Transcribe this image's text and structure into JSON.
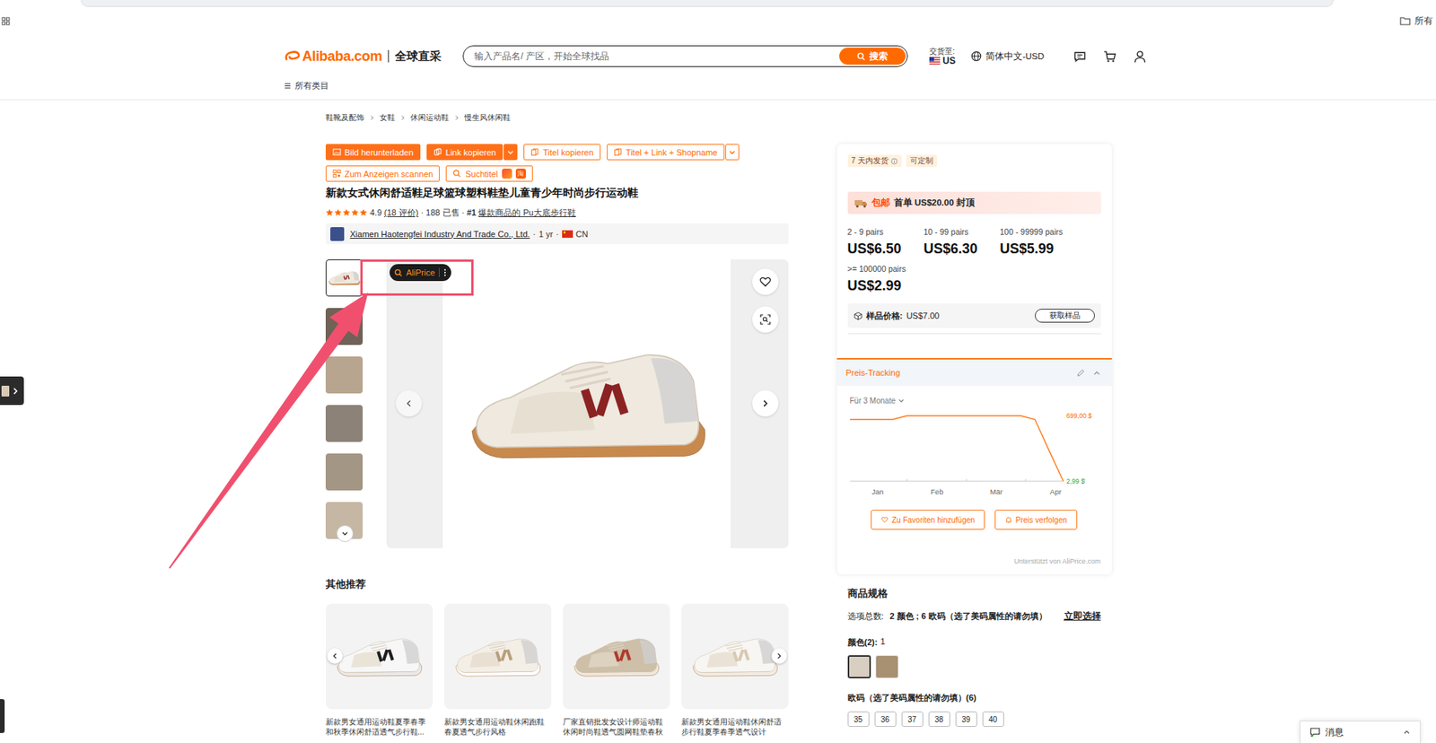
{
  "browser": {
    "bookmarks": "所有"
  },
  "header": {
    "logo": "Alibaba.com",
    "tagline": "全球直采",
    "search_placeholder": "输入产品名/ 产区，开始全球找品",
    "search_button": "搜索",
    "delivery_label": "交货至:",
    "delivery_country": "US",
    "language": "简体中文-USD",
    "categories": "所有类目"
  },
  "breadcrumb": [
    "鞋靴及配饰",
    "女鞋",
    "休闲运动鞋",
    "慢生风休闲鞋"
  ],
  "toolbar": [
    [
      {
        "label": "Bild herunterladen",
        "kind": "filled",
        "dropdown": false
      },
      {
        "label": "Link kopieren",
        "kind": "filled",
        "dropdown": true
      },
      {
        "label": "Titel kopieren",
        "kind": "outline",
        "dropdown": false
      },
      {
        "label": "Titel + Link + Shopname",
        "kind": "outline",
        "dropdown": true
      }
    ],
    [
      {
        "label": "Zum Anzeigen scannen",
        "kind": "outline",
        "dropdown": false
      },
      {
        "label": "Suchtitel",
        "kind": "outline",
        "dropdown": false,
        "badge": "淘"
      }
    ]
  ],
  "product": {
    "title": "新款女式休闲舒适鞋足球篮球塑料鞋垫儿童青少年时尚步行运动鞋",
    "stars": 5,
    "score": "4.9",
    "reviews": "(18 评价)",
    "sold": "188 已售",
    "rank": "#1",
    "rank_text": "爆款商品的 Pu大底步行鞋",
    "separator": "·",
    "supplier": "Xiamen Haotengfei Industry And Trade Co., Ltd.",
    "years": "1 yr",
    "country": "CN"
  },
  "gallery": {
    "thumbnails": [
      {
        "selected": true
      },
      {
        "selected": false
      },
      {
        "selected": false
      },
      {
        "selected": false
      },
      {
        "selected": false
      },
      {
        "selected": false
      }
    ],
    "overlay_button": "AliPrice"
  },
  "recommendations": {
    "title": "其他推荐",
    "items": [
      {
        "caption": "新款男女通用运动鞋夏季春季和秋季休闲舒适透气步行鞋..."
      },
      {
        "caption": "新款男女通用运动鞋休闲跑鞋春夏透气步行风格"
      },
      {
        "caption": "厂家直销批发女设计师运动鞋休闲时尚鞋透气圆网鞋垫春秋"
      },
      {
        "caption": "新款男女通用运动鞋休闲舒适步行鞋夏季春季透气设计"
      }
    ]
  },
  "offer": {
    "tags": [
      {
        "label": "7 天内发货",
        "info": true
      },
      {
        "label": "可定制",
        "info": false
      }
    ],
    "promo_badge": "包邮",
    "promo_text": "首单 US$20.00 封顶",
    "tiers": [
      {
        "qty": "2 - 9 pairs",
        "price": "US$6.50"
      },
      {
        "qty": "10 - 99 pairs",
        "price": "US$6.30"
      },
      {
        "qty": "100 - 99999 pairs",
        "price": "US$5.99"
      },
      {
        "qty": ">= 100000 pairs",
        "price": "US$2.99"
      }
    ],
    "sample_label": "样品价格:",
    "sample_price": "US$7.00",
    "sample_button": "获取样品"
  },
  "price_tracking": {
    "title": "Preis-Tracking",
    "range": "Für 3 Monate",
    "series": [
      660,
      660,
      660,
      660,
      699,
      699,
      699,
      699,
      699,
      699,
      699,
      699,
      699,
      660,
      330,
      2.99
    ],
    "max_label": "699,00 $",
    "min_label": "2,99 $",
    "months": [
      "Jan",
      "Feb",
      "Mär",
      "Apr"
    ],
    "buttons": [
      "Zu Favoriten hinzufügen",
      "Preis verfolgen"
    ],
    "credit": "Unterstützt von AliPrice.com"
  },
  "specs": {
    "title": "商品规格",
    "options_label": "选项总数:",
    "options_value": "2 颜色 ; 6 欧码（选了美码属性的请勿填）",
    "select_link": "立即选择",
    "color_label": "颜色(2):",
    "color_selected": "1",
    "swatches": [
      {
        "selected": true
      },
      {
        "selected": false
      }
    ],
    "size_label": "欧码（选了美码属性的请勿填）(6)",
    "sizes": [
      {
        "label": "35",
        "selected": false
      },
      {
        "label": "36",
        "selected": false
      },
      {
        "label": "37",
        "selected": false
      },
      {
        "label": "38",
        "selected": false
      },
      {
        "label": "39",
        "selected": false
      },
      {
        "label": "40",
        "selected": false
      }
    ]
  },
  "chat": {
    "label": "消息"
  }
}
